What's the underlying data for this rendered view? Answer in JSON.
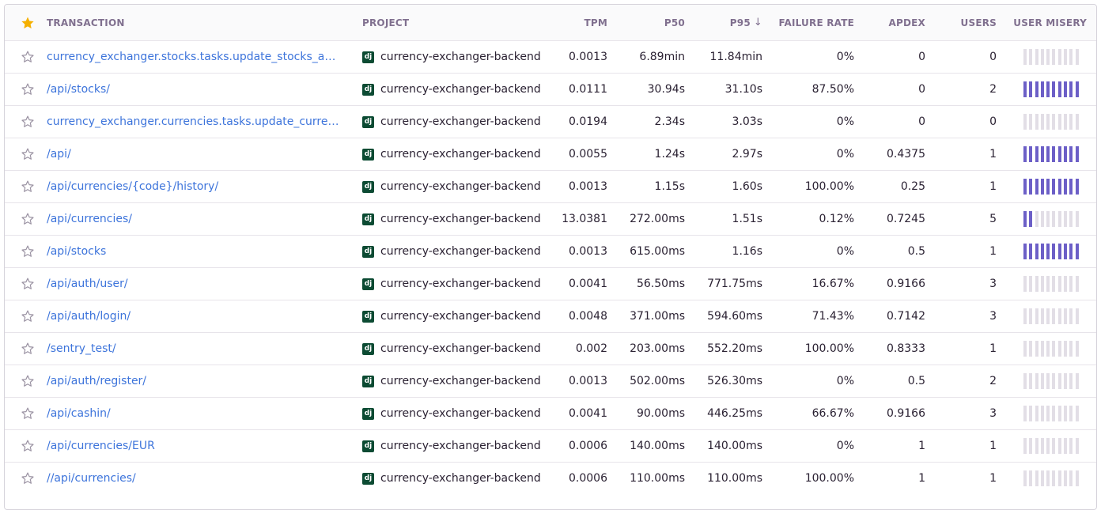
{
  "columns": {
    "transaction": "TRANSACTION",
    "project": "PROJECT",
    "tpm": "TPM",
    "p50": "P50",
    "p95": "P95",
    "p95_sort_icon": "arrow-down-icon",
    "failure_rate": "FAILURE RATE",
    "apdex": "APDEX",
    "users": "USERS",
    "user_misery": "USER MISERY"
  },
  "colors": {
    "star_active": "#f5b000",
    "link": "#3d74db",
    "misery_on": "#6c5fc7",
    "misery_off": "#e2dee6",
    "django": "#0c4b33"
  },
  "project_icon": "django-icon",
  "project_icon_text": "dj",
  "rows": [
    {
      "transaction": "currency_exchanger.stocks.tasks.update_stocks_async",
      "project": "currency-exchanger-backend",
      "tpm": "0.0013",
      "p50": "6.89min",
      "p95": "11.84min",
      "failure_rate": "0%",
      "apdex": "0",
      "users": "0",
      "misery_bars": 0
    },
    {
      "transaction": "/api/stocks/",
      "project": "currency-exchanger-backend",
      "tpm": "0.0111",
      "p50": "30.94s",
      "p95": "31.10s",
      "failure_rate": "87.50%",
      "apdex": "0",
      "users": "2",
      "misery_bars": 10
    },
    {
      "transaction": "currency_exchanger.currencies.tasks.update_currencies_async",
      "project": "currency-exchanger-backend",
      "tpm": "0.0194",
      "p50": "2.34s",
      "p95": "3.03s",
      "failure_rate": "0%",
      "apdex": "0",
      "users": "0",
      "misery_bars": 0
    },
    {
      "transaction": "/api/",
      "project": "currency-exchanger-backend",
      "tpm": "0.0055",
      "p50": "1.24s",
      "p95": "2.97s",
      "failure_rate": "0%",
      "apdex": "0.4375",
      "users": "1",
      "misery_bars": 10
    },
    {
      "transaction": "/api/currencies/{code}/history/",
      "project": "currency-exchanger-backend",
      "tpm": "0.0013",
      "p50": "1.15s",
      "p95": "1.60s",
      "failure_rate": "100.00%",
      "apdex": "0.25",
      "users": "1",
      "misery_bars": 10
    },
    {
      "transaction": "/api/currencies/",
      "project": "currency-exchanger-backend",
      "tpm": "13.0381",
      "p50": "272.00ms",
      "p95": "1.51s",
      "failure_rate": "0.12%",
      "apdex": "0.7245",
      "users": "5",
      "misery_bars": 2
    },
    {
      "transaction": "/api/stocks",
      "project": "currency-exchanger-backend",
      "tpm": "0.0013",
      "p50": "615.00ms",
      "p95": "1.16s",
      "failure_rate": "0%",
      "apdex": "0.5",
      "users": "1",
      "misery_bars": 10
    },
    {
      "transaction": "/api/auth/user/",
      "project": "currency-exchanger-backend",
      "tpm": "0.0041",
      "p50": "56.50ms",
      "p95": "771.75ms",
      "failure_rate": "16.67%",
      "apdex": "0.9166",
      "users": "3",
      "misery_bars": 0
    },
    {
      "transaction": "/api/auth/login/",
      "project": "currency-exchanger-backend",
      "tpm": "0.0048",
      "p50": "371.00ms",
      "p95": "594.60ms",
      "failure_rate": "71.43%",
      "apdex": "0.7142",
      "users": "3",
      "misery_bars": 0
    },
    {
      "transaction": "/sentry_test/",
      "project": "currency-exchanger-backend",
      "tpm": "0.002",
      "p50": "203.00ms",
      "p95": "552.20ms",
      "failure_rate": "100.00%",
      "apdex": "0.8333",
      "users": "1",
      "misery_bars": 0
    },
    {
      "transaction": "/api/auth/register/",
      "project": "currency-exchanger-backend",
      "tpm": "0.0013",
      "p50": "502.00ms",
      "p95": "526.30ms",
      "failure_rate": "0%",
      "apdex": "0.5",
      "users": "2",
      "misery_bars": 0
    },
    {
      "transaction": "/api/cashin/",
      "project": "currency-exchanger-backend",
      "tpm": "0.0041",
      "p50": "90.00ms",
      "p95": "446.25ms",
      "failure_rate": "66.67%",
      "apdex": "0.9166",
      "users": "3",
      "misery_bars": 0
    },
    {
      "transaction": "/api/currencies/EUR",
      "project": "currency-exchanger-backend",
      "tpm": "0.0006",
      "p50": "140.00ms",
      "p95": "140.00ms",
      "failure_rate": "0%",
      "apdex": "1",
      "users": "1",
      "misery_bars": 0
    },
    {
      "transaction": "//api/currencies/",
      "project": "currency-exchanger-backend",
      "tpm": "0.0006",
      "p50": "110.00ms",
      "p95": "110.00ms",
      "failure_rate": "100.00%",
      "apdex": "1",
      "users": "1",
      "misery_bars": 0
    }
  ]
}
